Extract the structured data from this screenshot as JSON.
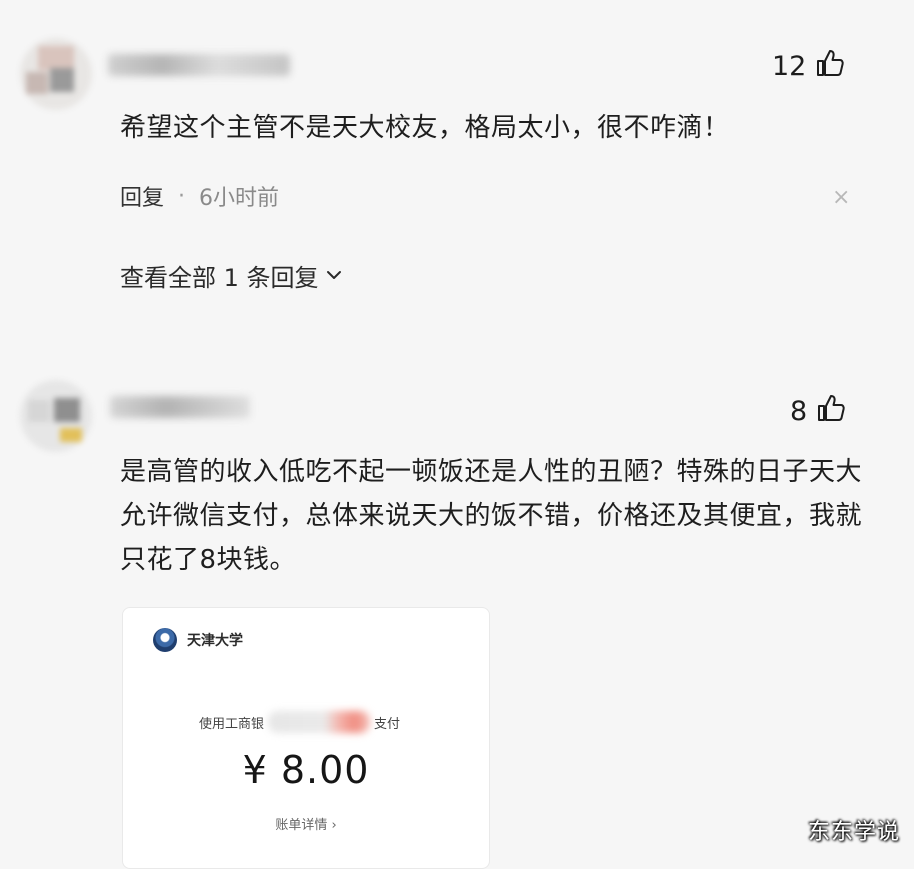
{
  "comments": [
    {
      "likes": "12",
      "text": "希望这个主管不是天大校友，格局太小，很不咋滴！",
      "reply_label": "回复",
      "separator": "·",
      "time": "6小时前",
      "close_glyph": "×",
      "expand_label": "查看全部 1 条回复"
    },
    {
      "likes": "8",
      "text": "是高管的收入低吃不起一顿饭还是人性的丑陋？特殊的日子天大允许微信支付，总体来说天大的饭不错，价格还及其便宜，我就只花了8块钱。"
    }
  ],
  "receipt": {
    "school": "天津大学",
    "pay_prefix": "使用工商银",
    "pay_suffix": "支付",
    "amount": "¥ 8.00",
    "detail": "账单详情 ›"
  },
  "watermark": "东东学说",
  "icons": {
    "thumb": "thumbs-up-icon",
    "chevron": "chevron-down-icon"
  },
  "colors": {
    "background": "#f6f6f6",
    "secondary_text": "#8a8a8a",
    "blur_accent": "#f08c80"
  }
}
